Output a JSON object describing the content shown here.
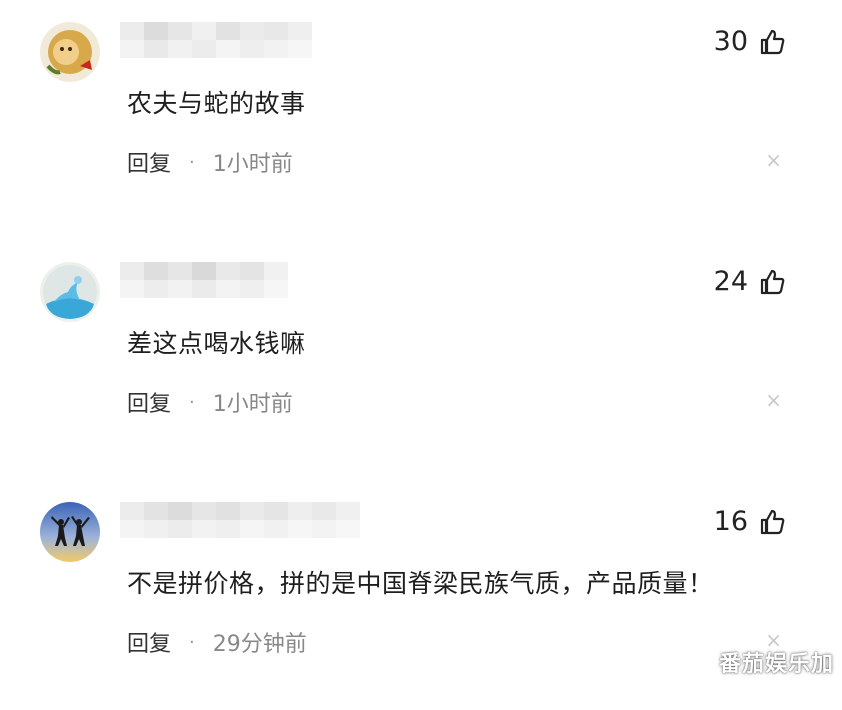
{
  "comments": [
    {
      "avatar": "monkey-avatar-icon",
      "text": "农夫与蛇的故事",
      "likes": "30",
      "reply_label": "回复",
      "time": "1小时前"
    },
    {
      "avatar": "whale-avatar-icon",
      "text": "差这点喝水钱嘛",
      "likes": "24",
      "reply_label": "回复",
      "time": "1小时前"
    },
    {
      "avatar": "jumping-people-avatar-icon",
      "text": "不是拼价格，拼的是中国脊梁民族气质，产品质量！",
      "likes": "16",
      "reply_label": "回复",
      "time": "29分钟前"
    }
  ],
  "separator": "·",
  "close_glyph": "×",
  "watermark": "番茄娱乐加",
  "colors": {
    "text": "#1e1e1e",
    "meta": "#888888",
    "close": "#c9c9c9"
  }
}
